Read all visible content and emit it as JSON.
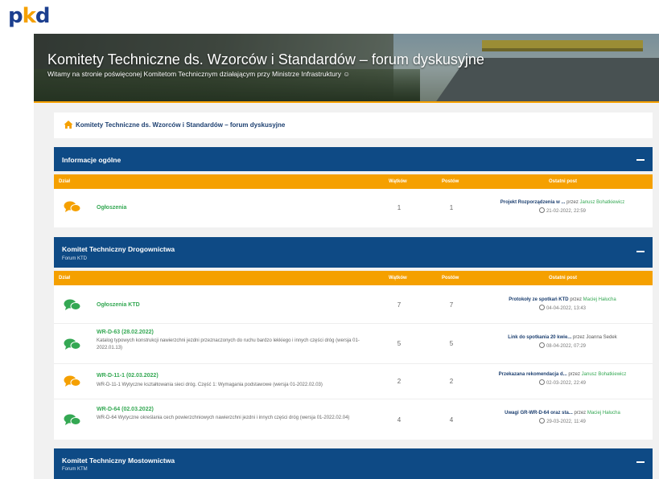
{
  "logo": {
    "text_p": "p",
    "text_k": "k",
    "text_d": "d"
  },
  "banner": {
    "title": "Komitety Techniczne ds. Wzorców i Standardów – forum dyskusyjne",
    "subtitle": "Witamy na stronie poświęconej Komitetom Technicznym działającym przy Ministrze Infrastruktury ☺"
  },
  "breadcrumb": {
    "label": "Komitety Techniczne ds. Wzorców i Standardów – forum dyskusyjne"
  },
  "columns": {
    "dzial": "Dział",
    "watkow": "Wątków",
    "postow": "Postów",
    "ostatni": "Ostatni post"
  },
  "sections": [
    {
      "title": "Informacje ogólne",
      "subtitle": "",
      "rows": [
        {
          "name": "Ogłoszenia",
          "desc": "",
          "icon_color": "orange",
          "threads": "1",
          "posts": "1",
          "last_title": "Projekt Rozporządzenia w ...",
          "last_by": "przez",
          "last_author": "Janusz Bohatkiewicz",
          "last_date": "21-02-2022, 22:59"
        }
      ]
    },
    {
      "title": "Komitet Techniczny Drogownictwa",
      "subtitle": "Forum KTD",
      "rows": [
        {
          "name": "Ogłoszenia KTD",
          "desc": "",
          "icon_color": "green",
          "threads": "7",
          "posts": "7",
          "last_title": "Protokoły ze spotkań KTD",
          "last_by": "przez",
          "last_author": "Maciej Hałucha",
          "last_date": "04-04-2022, 13:43"
        },
        {
          "name": "WR-D-63 (28.02.2022)",
          "desc": "Katalog typowych konstrukcji nawierzchni jezdni przeznaczonych do ruchu bardzo lekkiego i innych części dróg (wersja 01-2022.01.13)",
          "icon_color": "green",
          "threads": "5",
          "posts": "5",
          "last_title": "Link do spotkania 20 kwie...",
          "last_by": "przez",
          "last_author": "Joanna Sedek",
          "last_date": "08-04-2022, 07:29"
        },
        {
          "name": "WR-D-11-1 (02.03.2022)",
          "desc": "WR-D-11-1 Wytyczne kształtowania sieci dróg. Część 1: Wymagania podstawowe (wersja 01-2022.02.03)",
          "icon_color": "orange",
          "threads": "2",
          "posts": "2",
          "last_title": "Przekazana rekomendacja d...",
          "last_by": "przez",
          "last_author": "Janusz Bohatkiewicz",
          "last_date": "02-03-2022, 22:49"
        },
        {
          "name": "WR-D-64 (02.03.2022)",
          "desc": "WR-D-64 Wytyczne określania cech powierzchniowych nawierzchni jezdni i innych części dróg (wersja 01-2022.02.04)",
          "icon_color": "green",
          "threads": "4",
          "posts": "4",
          "last_title": "Uwagi GR-WR-D-64 oraz sta...",
          "last_by": "przez",
          "last_author": "Maciej Hałucha",
          "last_date": "29-03-2022, 11:49"
        }
      ]
    },
    {
      "title": "Komitet Techniczny Mostownictwa",
      "subtitle": "Forum KTM",
      "rows": []
    }
  ],
  "colors": {
    "navy": "#0e4a85",
    "orange": "#f5a000",
    "green": "#34a853"
  }
}
